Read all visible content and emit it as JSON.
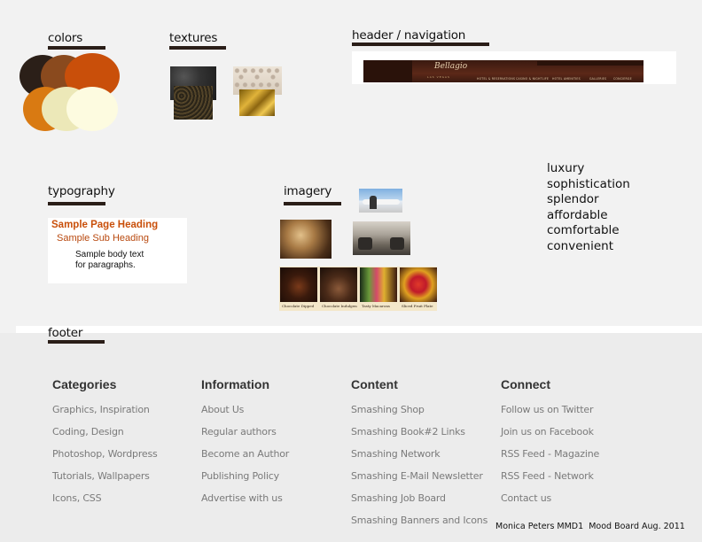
{
  "sections": {
    "colors": "colors",
    "textures": "textures",
    "header": "header / navigation",
    "typography": "typography",
    "imagery": "imagery",
    "footer": "footer"
  },
  "palette": [
    "#2b1f18",
    "#8a4a1e",
    "#c94f0a",
    "#d97a12",
    "#ece8b8",
    "#fdfbe0"
  ],
  "header_mock": {
    "logo": "Bellagio",
    "logo_sub": "LAS VEGAS",
    "tabs": [
      "HOTEL & RESERVATIONS",
      "CASINO & NIGHTLIFE",
      "HOTEL AMENITIES",
      "GALLERIES",
      "CONCIERGE"
    ]
  },
  "typography": {
    "heading": "Sample Page Heading",
    "subheading": "Sample Sub Heading",
    "body_line1": "Sample body text",
    "body_line2": "for paragraphs."
  },
  "imagery": {
    "captions": [
      "Chocolate Dipped",
      "Chocolate Indulgence",
      "Tasty Macarons",
      "Sliced Fruit Plate"
    ]
  },
  "keywords": [
    "luxury",
    "sophistication",
    "splendor",
    "affordable",
    "comfortable",
    "convenient"
  ],
  "footer": {
    "columns": [
      {
        "title": "Categories",
        "links": [
          "Graphics, Inspiration",
          "Coding, Design",
          "Photoshop, Wordpress",
          "Tutorials, Wallpapers",
          "Icons, CSS"
        ]
      },
      {
        "title": "Information",
        "links": [
          "About Us",
          "Regular authors",
          "Become an Author",
          "Publishing Policy",
          "Advertise with us"
        ]
      },
      {
        "title": "Content",
        "links": [
          "Smashing Shop",
          "Smashing Book#2 Links",
          "Smashing Network",
          "Smashing E-Mail Newsletter",
          "Smashing Job Board",
          "Smashing Banners and Icons"
        ]
      },
      {
        "title": "Connect",
        "links": [
          "Follow us on Twitter",
          "Join us on Facebook",
          "RSS Feed - Magazine",
          "RSS Feed - Network",
          "Contact us"
        ]
      }
    ]
  },
  "credit": "Monica Peters MMD1  Mood Board Aug. 2011"
}
